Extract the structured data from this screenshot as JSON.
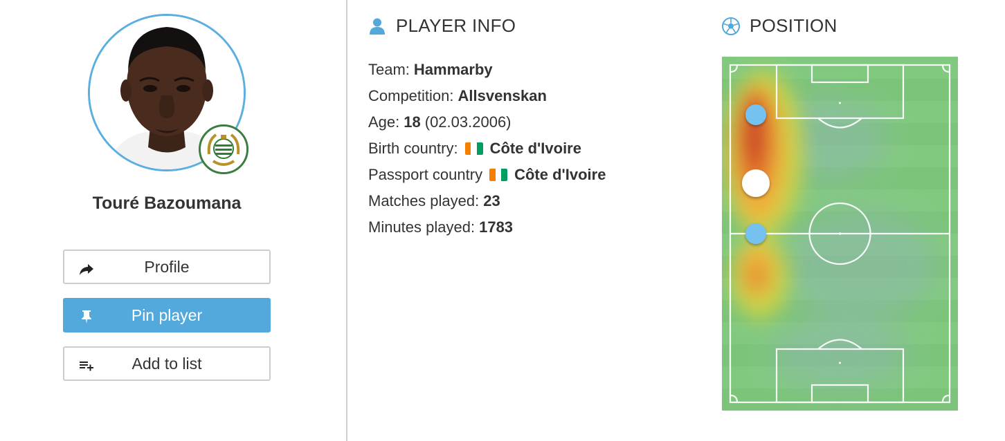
{
  "player": {
    "name": "Touré Bazoumana"
  },
  "actions": {
    "profile_label": "Profile",
    "pin_label": "Pin player",
    "add_list_label": "Add to list"
  },
  "info": {
    "title": "PLAYER INFO",
    "team_label": "Team:",
    "team": "Hammarby",
    "competition_label": "Competition:",
    "competition": "Allsvenskan",
    "age_label": "Age:",
    "age": "18",
    "birth_date": "(02.03.2006)",
    "birth_country_label": "Birth country:",
    "birth_country": "Côte d'Ivoire",
    "passport_country_label": "Passport country",
    "passport_country": "Côte d'Ivoire",
    "matches_label": "Matches played:",
    "matches": "23",
    "minutes_label": "Minutes played:",
    "minutes": "1783"
  },
  "position": {
    "title": "POSITION"
  },
  "icons": {
    "profile": "share-arrow-icon",
    "pin": "pin-icon",
    "add_list": "playlist-add-icon",
    "info": "user-icon",
    "position": "soccer-ball-icon"
  },
  "colors": {
    "accent": "#53a8dc",
    "avatar_ring": "#5aaee0",
    "badge_ring": "#3b7d3f",
    "pitch_green": "#7cc47a",
    "flag_orange": "#f77f00",
    "flag_white": "#ffffff",
    "flag_green": "#009e60"
  }
}
